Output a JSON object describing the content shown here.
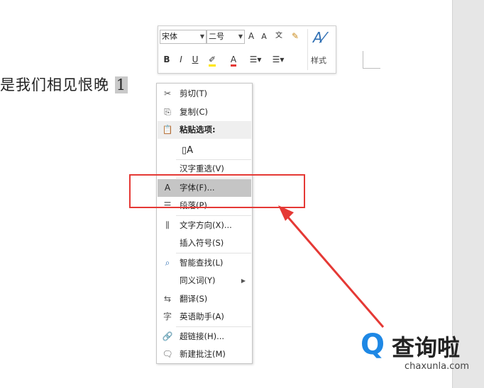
{
  "document": {
    "text": "是我们相见恨晚 ",
    "selected": "1"
  },
  "mini_toolbar": {
    "font_name": "宋体",
    "font_size": "二号",
    "grow_font": "A",
    "shrink_font": "A",
    "phonetic": "文",
    "bold": "B",
    "italic": "I",
    "underline": "U",
    "font_color": "A",
    "styles_label": "样式"
  },
  "context_menu": {
    "items": [
      {
        "icon": "cut-icon",
        "label": "剪切(T)"
      },
      {
        "icon": "copy-icon",
        "label": "复制(C)"
      },
      {
        "icon": "paste-icon",
        "label": "粘贴选项:"
      },
      {
        "icon": "keep-text-only-icon",
        "label": "A"
      },
      {
        "icon": "",
        "label": "汉字重选(V)"
      },
      {
        "icon": "font-icon",
        "label": "字体(F)..."
      },
      {
        "icon": "paragraph-icon",
        "label": "段落(P)..."
      },
      {
        "icon": "text-direction-icon",
        "label": "文字方向(X)..."
      },
      {
        "icon": "",
        "label": "插入符号(S)"
      },
      {
        "icon": "smart-lookup-icon",
        "label": "智能查找(L)"
      },
      {
        "icon": "",
        "label": "同义词(Y)"
      },
      {
        "icon": "translate-icon",
        "label": "翻译(S)"
      },
      {
        "icon": "english-assistant-icon",
        "label": "英语助手(A)"
      },
      {
        "icon": "hyperlink-icon",
        "label": "超链接(H)..."
      },
      {
        "icon": "new-comment-icon",
        "label": "新建批注(M)"
      }
    ]
  },
  "watermark": {
    "name": "查询啦",
    "domain": "chaxunla.com"
  },
  "colors": {
    "highlight": "#e53935",
    "accent": "#1e88e5"
  }
}
